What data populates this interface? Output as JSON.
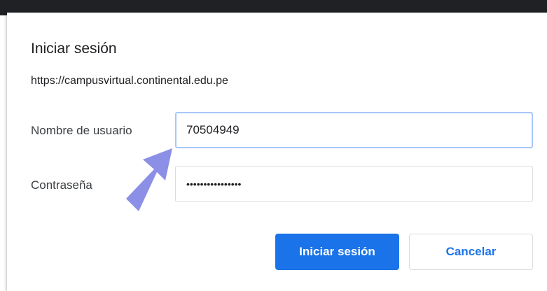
{
  "dialog": {
    "title": "Iniciar sesión",
    "origin": "https://campusvirtual.continental.edu.pe",
    "username_label": "Nombre de usuario",
    "username_value": "70504949",
    "password_label": "Contraseña",
    "password_mask": "••••••••••••••••",
    "submit_label": "Iniciar sesión",
    "cancel_label": "Cancelar"
  },
  "colors": {
    "accent": "#1a73e8",
    "arrow": "#8b8fe6",
    "focus_border": "#a8c7fa"
  },
  "annotation": {
    "icon": "pointer-arrow-icon"
  }
}
